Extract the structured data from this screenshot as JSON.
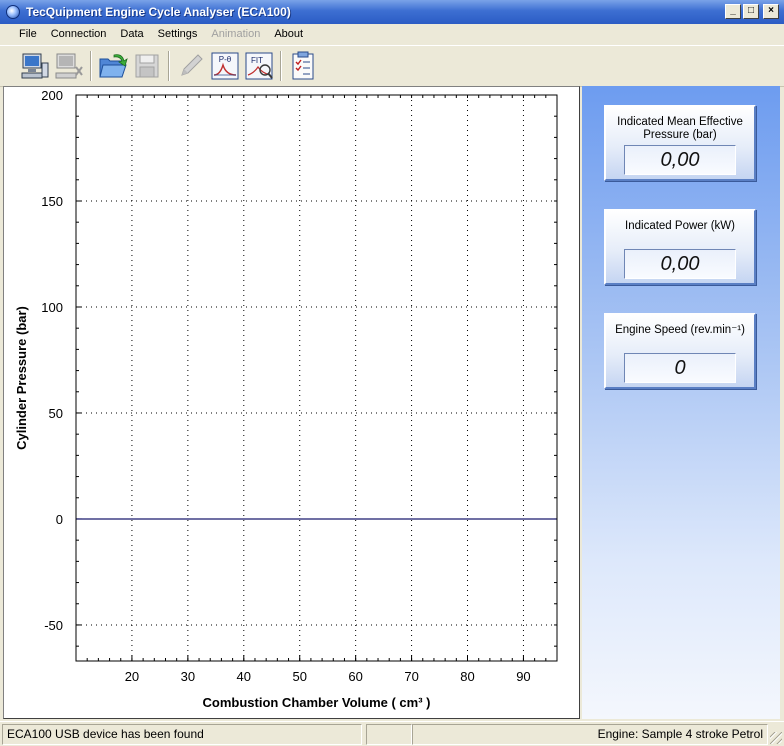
{
  "window": {
    "title": "TecQuipment Engine Cycle Analyser (ECA100)",
    "controls": [
      "_",
      "□",
      "×"
    ]
  },
  "menu": {
    "items": [
      {
        "label": "File",
        "enabled": true
      },
      {
        "label": "Connection",
        "enabled": true
      },
      {
        "label": "Data",
        "enabled": true
      },
      {
        "label": "Settings",
        "enabled": true
      },
      {
        "label": "Animation",
        "enabled": false
      },
      {
        "label": "About",
        "enabled": true
      }
    ]
  },
  "toolbar": {
    "buttons": [
      {
        "icon": "connect-computer-icon",
        "enabled": true
      },
      {
        "icon": "disconnect-computer-icon",
        "enabled": false
      },
      {
        "icon": "open-folder-icon",
        "enabled": true
      },
      {
        "icon": "save-disk-icon",
        "enabled": false
      },
      {
        "icon": "pencil-icon",
        "enabled": false
      },
      {
        "icon": "p-theta-plot-icon",
        "label": "P-θ",
        "enabled": true
      },
      {
        "icon": "fit-plot-icon",
        "label": "FIT",
        "enabled": true
      },
      {
        "icon": "report-checklist-icon",
        "enabled": true
      }
    ]
  },
  "chart_data": {
    "type": "line",
    "xlabel": "Combustion Chamber Volume ( cm³ )",
    "ylabel": "Cylinder Pressure (bar)",
    "xlim": [
      10,
      96
    ],
    "ylim": [
      -67,
      200
    ],
    "x_ticks": [
      20,
      30,
      40,
      50,
      60,
      70,
      80,
      90
    ],
    "y_ticks": [
      200,
      150,
      100,
      50,
      0,
      -50
    ],
    "grid": true,
    "series": [
      {
        "x": [
          10,
          96
        ],
        "y": [
          0,
          0
        ]
      }
    ],
    "colors": {
      "zero_line": "#1a1a6e",
      "grid": "#000000"
    }
  },
  "readouts": [
    {
      "label": "Indicated Mean Effective Pressure (bar)",
      "value": "0,00"
    },
    {
      "label": "Indicated Power (kW)",
      "value": "0,00"
    },
    {
      "label": "Engine Speed (rev.min⁻¹)",
      "value": "0"
    }
  ],
  "status": {
    "left": "ECA100 USB device has been found",
    "middle": "",
    "right": "Engine: Sample 4 stroke Petrol"
  },
  "colors": {
    "titlebar": "#2b5cc4",
    "panel_top": "#6d9cf0",
    "panel_bottom": "#f4f7fd"
  }
}
